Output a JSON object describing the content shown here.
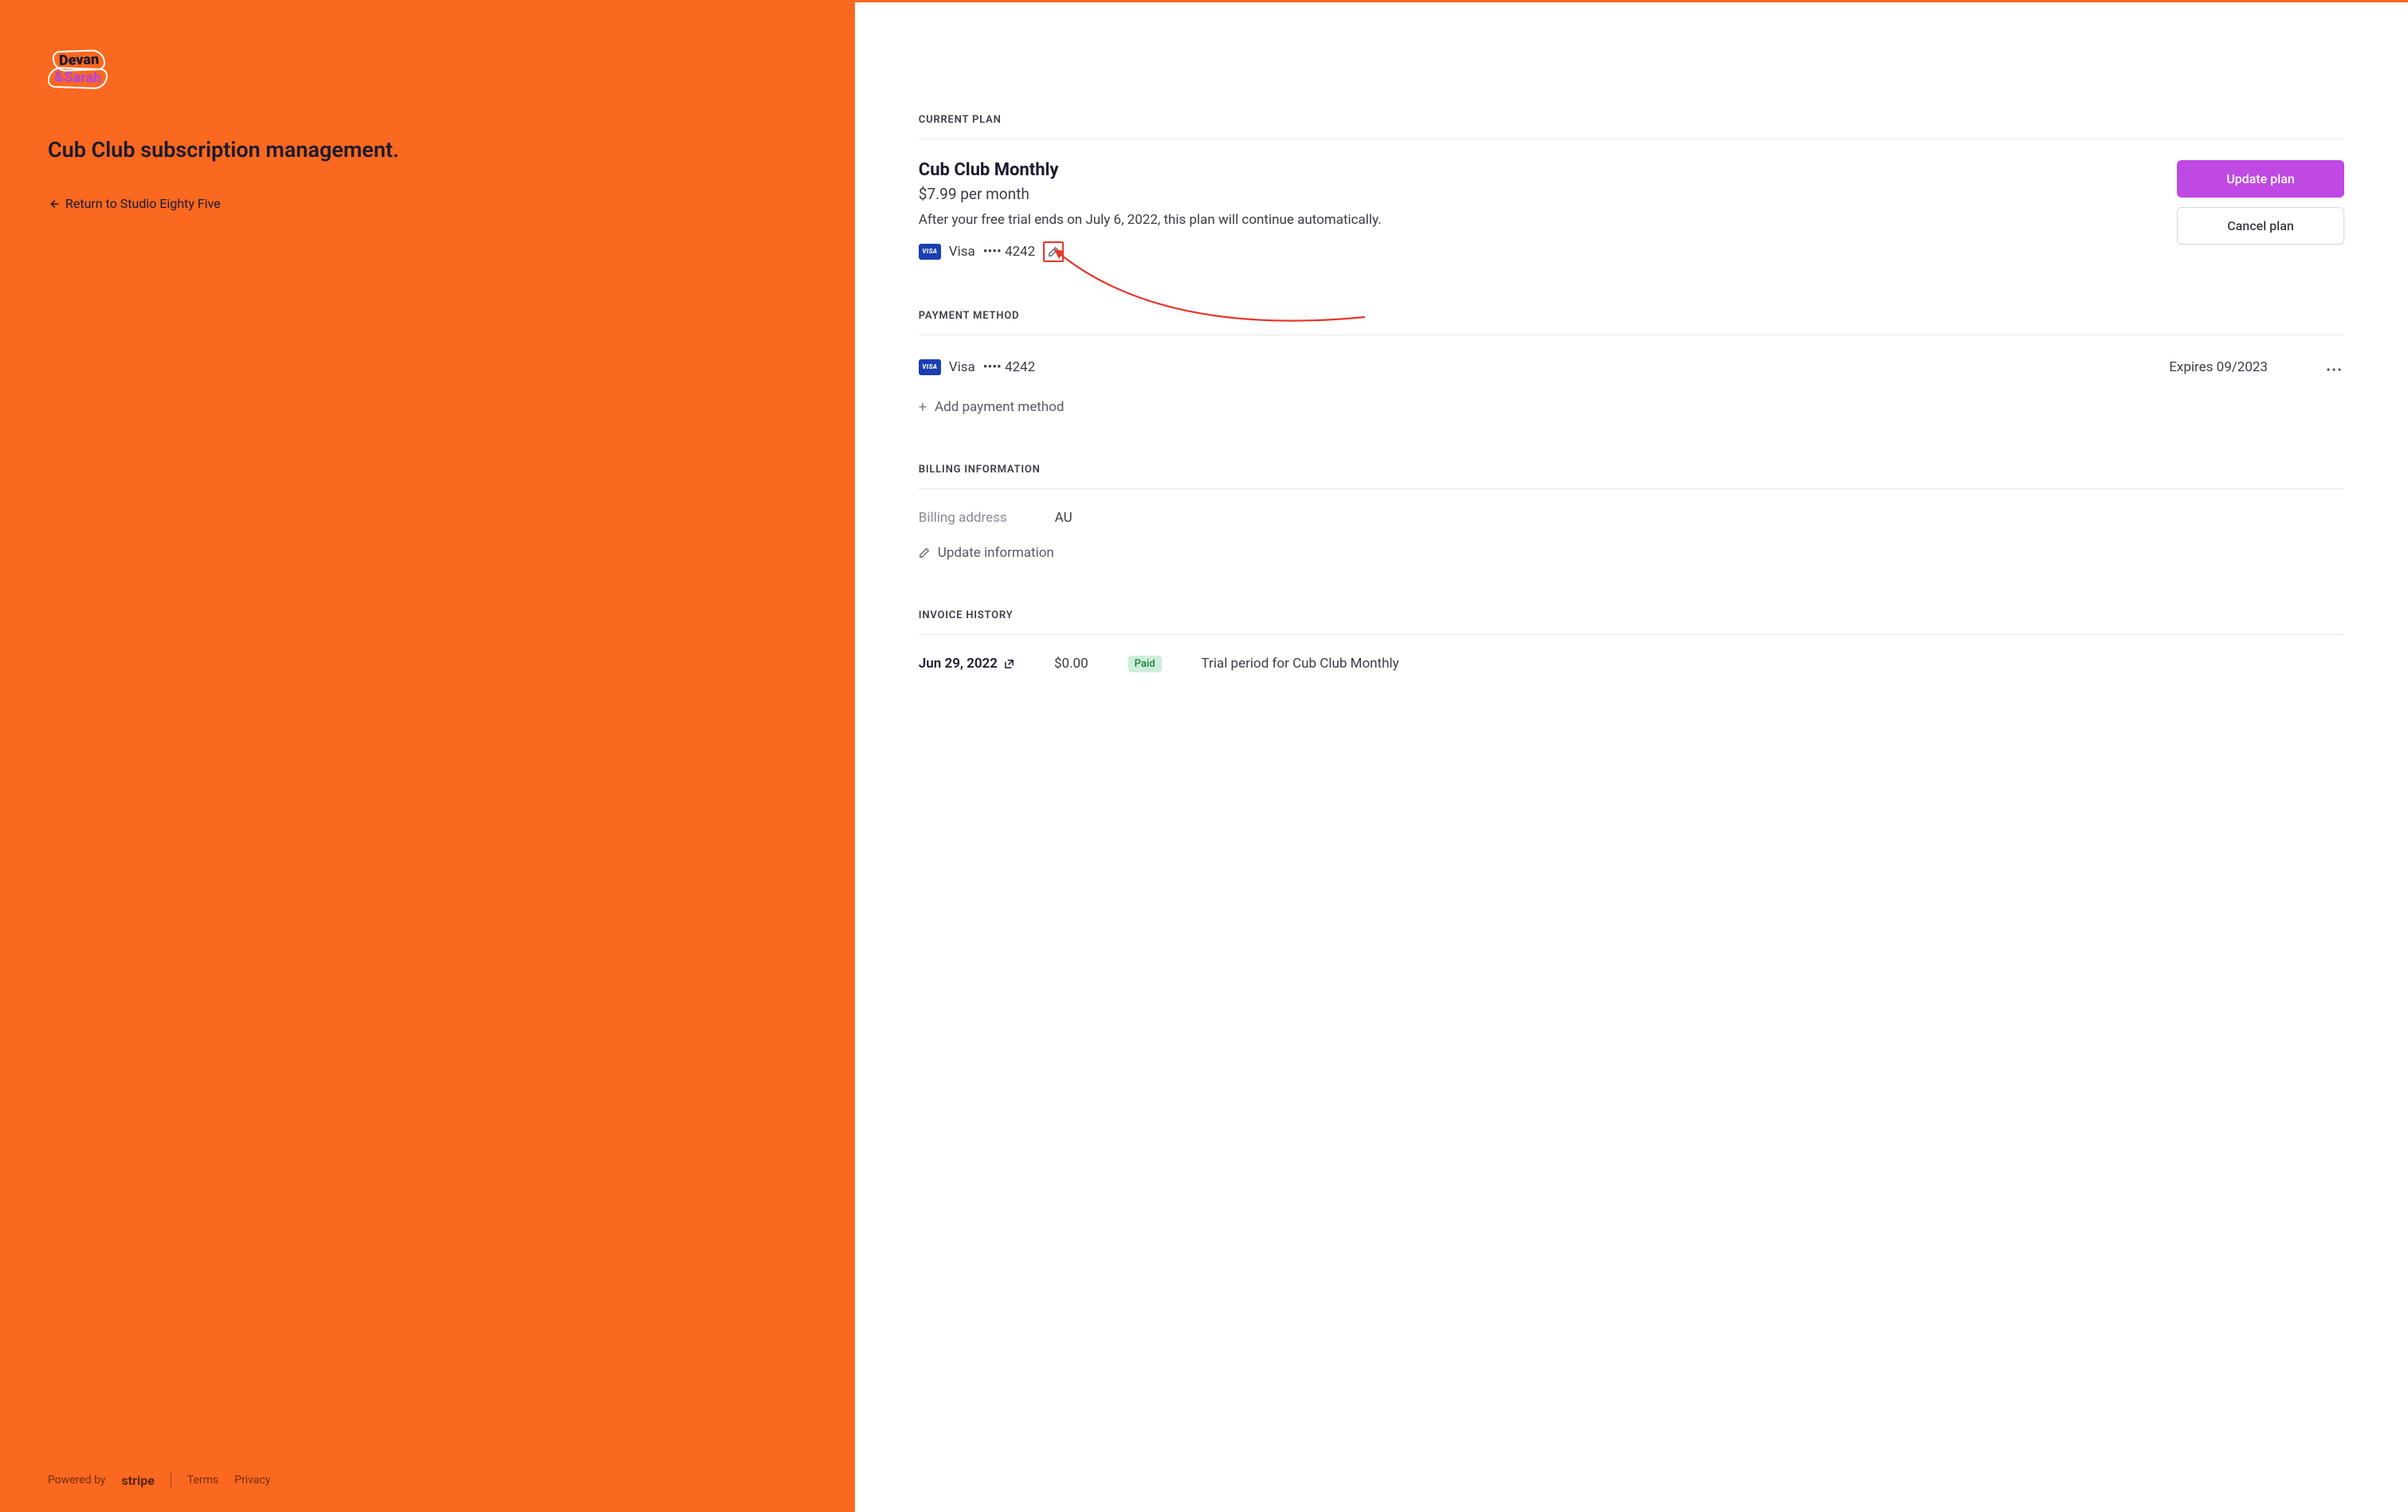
{
  "sidebar": {
    "logo_top": "Devan",
    "logo_bottom": "&Sarah",
    "title": "Cub Club subscription management.",
    "return_label": "Return to Studio Eighty Five",
    "powered_by": "Powered by",
    "stripe": "stripe",
    "terms": "Terms",
    "privacy": "Privacy"
  },
  "current_plan": {
    "section_title": "CURRENT PLAN",
    "name": "Cub Club Monthly",
    "price": "$7.99 per month",
    "note": "After your free trial ends on July 6, 2022, this plan will continue automatically.",
    "card_brand": "Visa",
    "card_mask": "•••• 4242",
    "update_label": "Update plan",
    "cancel_label": "Cancel plan"
  },
  "payment_method": {
    "section_title": "PAYMENT METHOD",
    "card_brand": "Visa",
    "card_mask": "•••• 4242",
    "expires": "Expires 09/2023",
    "add_label": "Add payment method"
  },
  "billing": {
    "section_title": "BILLING INFORMATION",
    "address_label": "Billing address",
    "address_value": "AU",
    "update_label": "Update information"
  },
  "invoices": {
    "section_title": "INVOICE HISTORY",
    "rows": [
      {
        "date": "Jun 29, 2022",
        "amount": "$0.00",
        "status": "Paid",
        "description": "Trial period for Cub Club Monthly"
      }
    ]
  },
  "visa_badge_text": "VISA"
}
